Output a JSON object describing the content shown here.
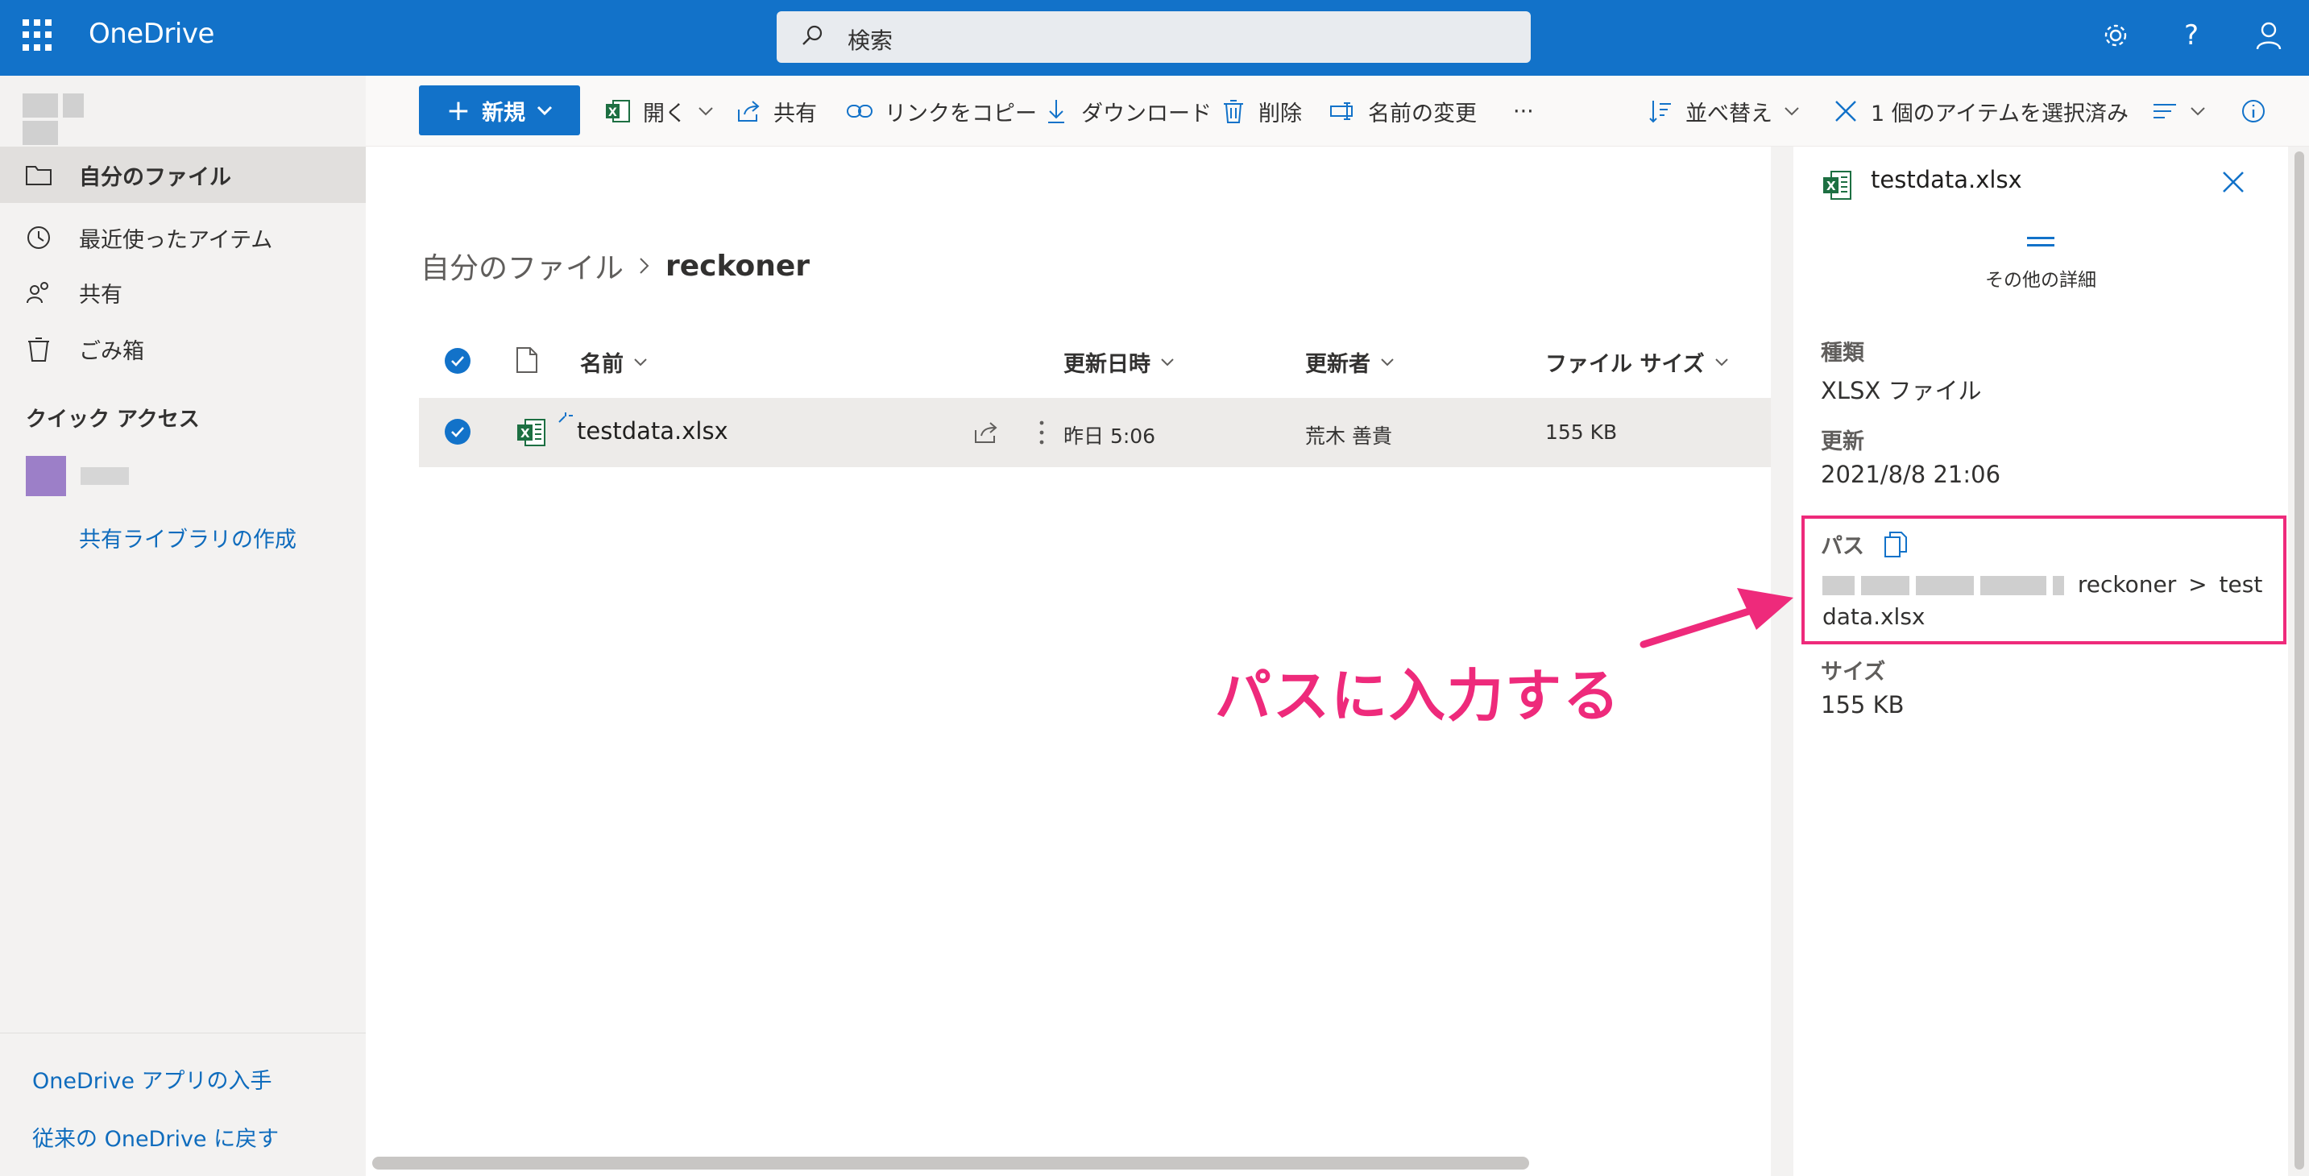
{
  "app": {
    "name": "OneDrive"
  },
  "search": {
    "placeholder": "検索"
  },
  "topbar": {
    "settings_icon": "gear-icon",
    "help": "?",
    "account_icon": "person-icon"
  },
  "sidebar": {
    "items": [
      {
        "label": "自分のファイル",
        "icon": "folder-icon",
        "active": true
      },
      {
        "label": "最近使ったアイテム",
        "icon": "history-icon",
        "active": false
      },
      {
        "label": "共有",
        "icon": "people-icon",
        "active": false
      },
      {
        "label": "ごみ箱",
        "icon": "trash-icon",
        "active": false
      }
    ],
    "quick_access_title": "クイック アクセス",
    "create_library": "共有ライブラリの作成",
    "get_app": "OneDrive アプリの入手",
    "back_classic": "従来の OneDrive に戻す"
  },
  "commandbar": {
    "new": "新規",
    "open": "開く",
    "share": "共有",
    "copy_link": "リンクをコピー",
    "download": "ダウンロード",
    "delete": "削除",
    "rename": "名前の変更",
    "more": "···",
    "sort": "並べ替え",
    "selected": "1 個のアイテムを選択済み"
  },
  "breadcrumb": {
    "parent": "自分のファイル",
    "current": "reckoner"
  },
  "table": {
    "headers": {
      "name": "名前",
      "modified": "更新日時",
      "modified_by": "更新者",
      "size": "ファイル サイズ"
    },
    "rows": [
      {
        "name": "testdata.xlsx",
        "modified": "昨日 5:06",
        "modified_by": "荒木 善貴",
        "size": "155 KB"
      }
    ]
  },
  "details": {
    "title": "testdata.xlsx",
    "more_details": "その他の詳細",
    "type_label": "種類",
    "type_value": "XLSX ファイル",
    "modified_label": "更新",
    "modified_value": "2021/8/8 21:06",
    "path_label": "パス",
    "path_value_1": "reckoner",
    "path_sep": ">",
    "path_value_2": "test",
    "path_value_3": "data.xlsx",
    "size_label": "サイズ",
    "size_value": "155 KB"
  },
  "annotation": {
    "text": "パスに入力する",
    "color": "#ee2a7b"
  },
  "colors": {
    "brand": "#1272c9",
    "sidebar_bg": "#f3f2f1",
    "selected_row": "#edebe9",
    "excel": "#1d6f42"
  }
}
